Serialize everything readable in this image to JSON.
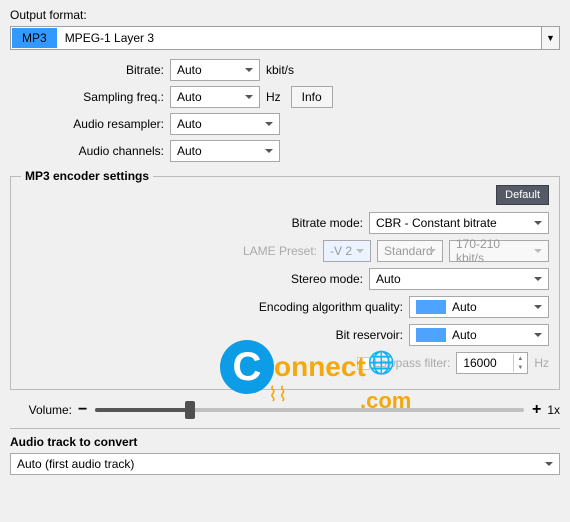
{
  "output": {
    "label": "Output format:",
    "badge": "MP3",
    "desc": "MPEG-1 Layer 3"
  },
  "general": {
    "bitrate_label": "Bitrate:",
    "bitrate_value": "Auto",
    "bitrate_unit": "kbit/s",
    "sampling_label": "Sampling freq.:",
    "sampling_value": "Auto",
    "sampling_unit": "Hz",
    "info_label": "Info",
    "resampler_label": "Audio resampler:",
    "resampler_value": "Auto",
    "channels_label": "Audio channels:",
    "channels_value": "Auto"
  },
  "encoder": {
    "legend": "MP3 encoder settings",
    "default_btn": "Default",
    "bitrate_mode_label": "Bitrate mode:",
    "bitrate_mode_value": "CBR - Constant bitrate",
    "lame_label": "LAME Preset:",
    "lame_v": "-V 2",
    "lame_std": "Standard",
    "lame_kbit": "170-210 kbit/s",
    "stereo_label": "Stereo mode:",
    "stereo_value": "Auto",
    "quality_label": "Encoding algorithm quality:",
    "quality_value": "Auto",
    "reservoir_label": "Bit reservoir:",
    "reservoir_value": "Auto",
    "lowpass_label": "Lowpass filter:",
    "lowpass_value": "16000",
    "lowpass_unit": "Hz"
  },
  "volume": {
    "label": "Volume:",
    "minus": "−",
    "plus": "+",
    "readout": "1x"
  },
  "track": {
    "label": "Audio track to convert",
    "value": "Auto (first audio track)"
  },
  "watermark": {
    "c": "C",
    "text1": "onnect",
    "text2": ".com"
  }
}
